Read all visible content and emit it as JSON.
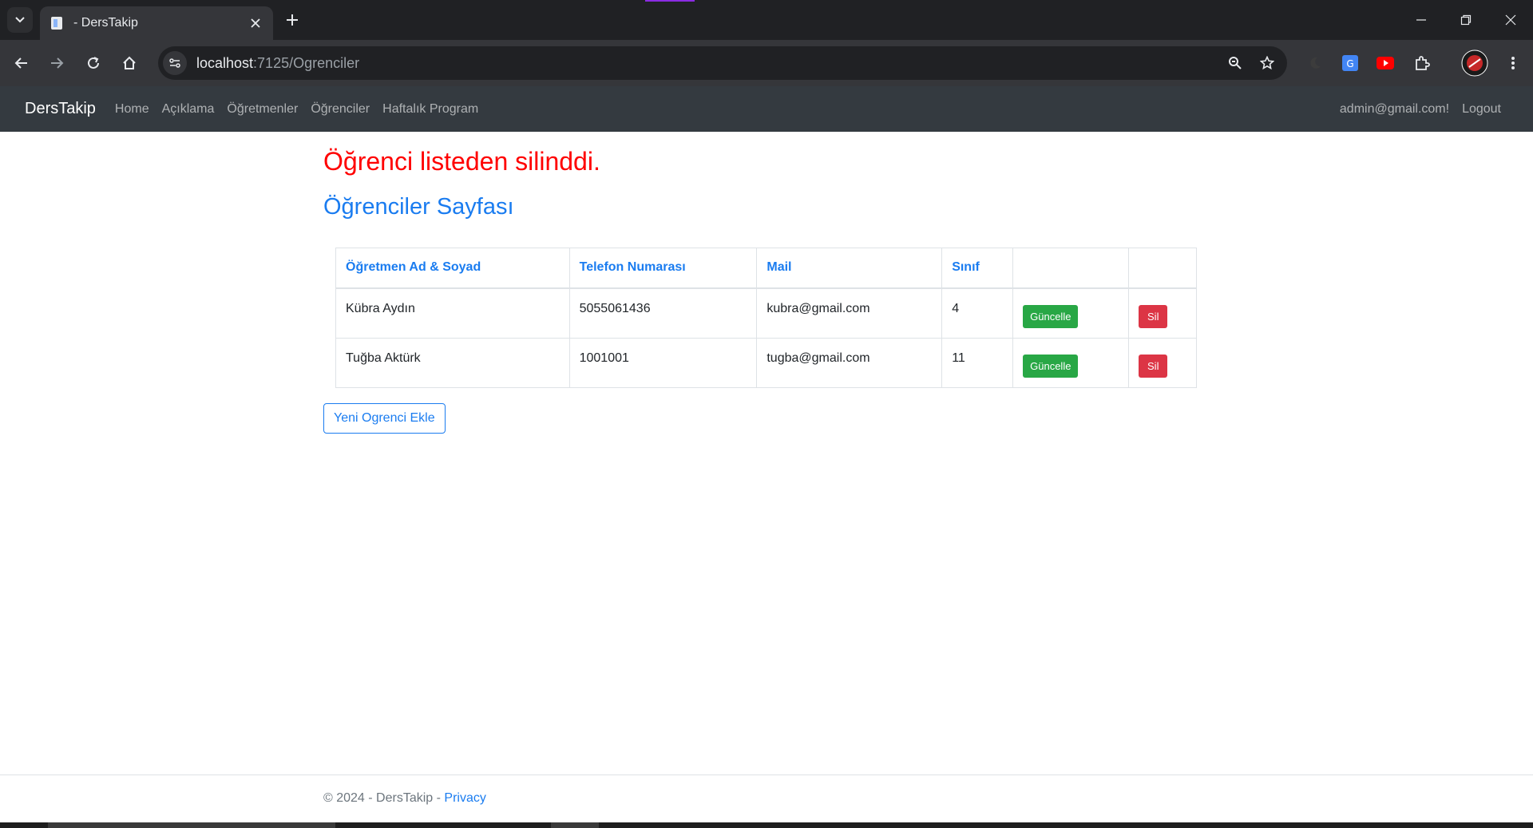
{
  "browser": {
    "tab_title": "- DersTakip",
    "url_host": "localhost",
    "url_path": ":7125/Ogrenciler"
  },
  "navbar": {
    "brand": "DersTakip",
    "links": [
      "Home",
      "Açıklama",
      "Öğretmenler",
      "Öğrenciler",
      "Haftalık Program"
    ],
    "user": "admin@gmail.com!",
    "logout": "Logout"
  },
  "main": {
    "alert": "Öğrenci listeden silinddi.",
    "title": "Öğrenciler Sayfası",
    "table": {
      "headers": [
        "Öğretmen Ad & Soyad",
        "Telefon Numarası",
        "Mail",
        "Sınıf",
        "",
        ""
      ],
      "rows": [
        {
          "name": "Kübra Aydın",
          "phone": "5055061436",
          "mail": "kubra@gmail.com",
          "class": "4",
          "update": "Güncelle",
          "delete": "Sil"
        },
        {
          "name": "Tuğba Aktürk",
          "phone": "1001001",
          "mail": "tugba@gmail.com",
          "class": "11",
          "update": "Güncelle",
          "delete": "Sil"
        }
      ]
    },
    "new_button": "Yeni Ogrenci Ekle"
  },
  "footer": {
    "text": "© 2024 - DersTakip - ",
    "privacy": "Privacy"
  },
  "colors": {
    "alert": "#ff0000",
    "primary": "#1a7cf0",
    "success": "#28a745",
    "danger": "#dc3545",
    "navbar": "#343a40"
  }
}
